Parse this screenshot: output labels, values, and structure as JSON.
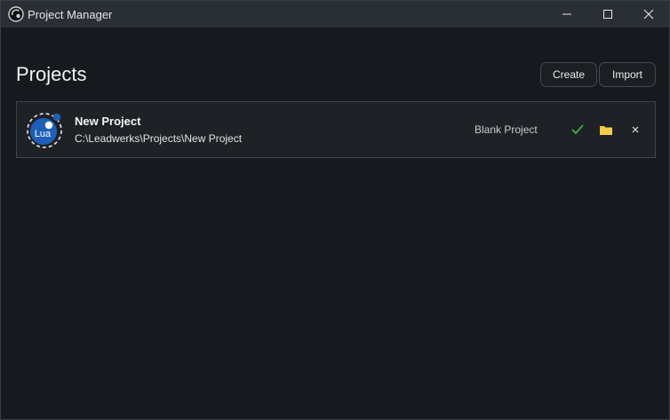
{
  "window": {
    "title": "Project Manager",
    "controls": {
      "minimize_icon": "minimize-icon",
      "maximize_icon": "maximize-icon",
      "close_icon": "close-icon"
    }
  },
  "header": {
    "title": "Projects",
    "buttons": {
      "create": "Create",
      "import": "Import"
    }
  },
  "projects": [
    {
      "name": "New Project",
      "path": "C:\\Leadwerks\\Projects\\New Project",
      "template": "Blank Project",
      "language_badge": "Lua",
      "actions": [
        "check-icon",
        "folder-icon",
        "remove-icon"
      ]
    }
  ],
  "colors": {
    "check": "#3cc83c",
    "folder": "#f4c53a",
    "lua_blue": "#1f5fb8"
  }
}
